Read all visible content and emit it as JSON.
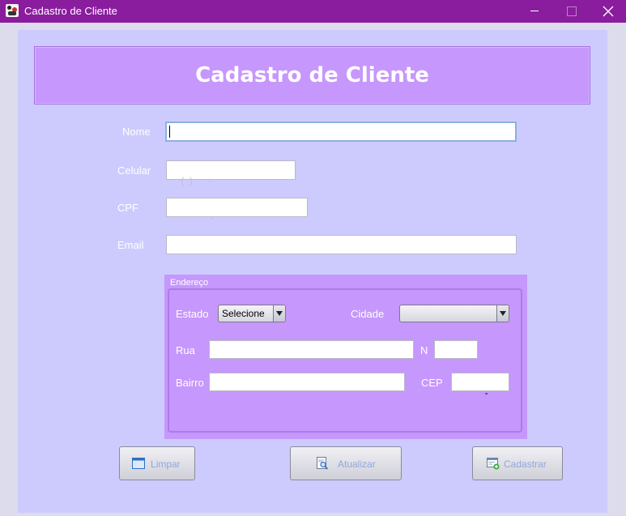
{
  "window": {
    "title": "Cadastro de Cliente"
  },
  "header": {
    "title": "Cadastro de Cliente"
  },
  "form": {
    "nome_label": "Nome",
    "nome_value": "",
    "celular_label": "Celular",
    "celular_mask": "(  )      -",
    "cpf_label": "CPF",
    "cpf_mask": "   .   .   -",
    "email_label": "Email",
    "email_value": ""
  },
  "address": {
    "group_title": "Endereço",
    "estado_label": "Estado",
    "estado_value": "Selecione",
    "cidade_label": "Cidade",
    "cidade_value": "",
    "rua_label": "Rua",
    "numero_label": "N",
    "bairro_label": "Bairro",
    "cep_label": "CEP",
    "cep_mask": "     -"
  },
  "buttons": {
    "limpar": "Limpar",
    "atualizar": "Atualizar",
    "cadastrar": "Cadastrar"
  },
  "icons": {
    "app": "app-icon",
    "limpar": "window-icon",
    "atualizar": "search-document-icon",
    "cadastrar": "add-document-icon"
  },
  "colors": {
    "titlebar": "#8a1c9e",
    "panel": "#cdcbfd",
    "header": "#c697fc",
    "group": "#c697fc",
    "button_text": "#8ea8dc"
  }
}
